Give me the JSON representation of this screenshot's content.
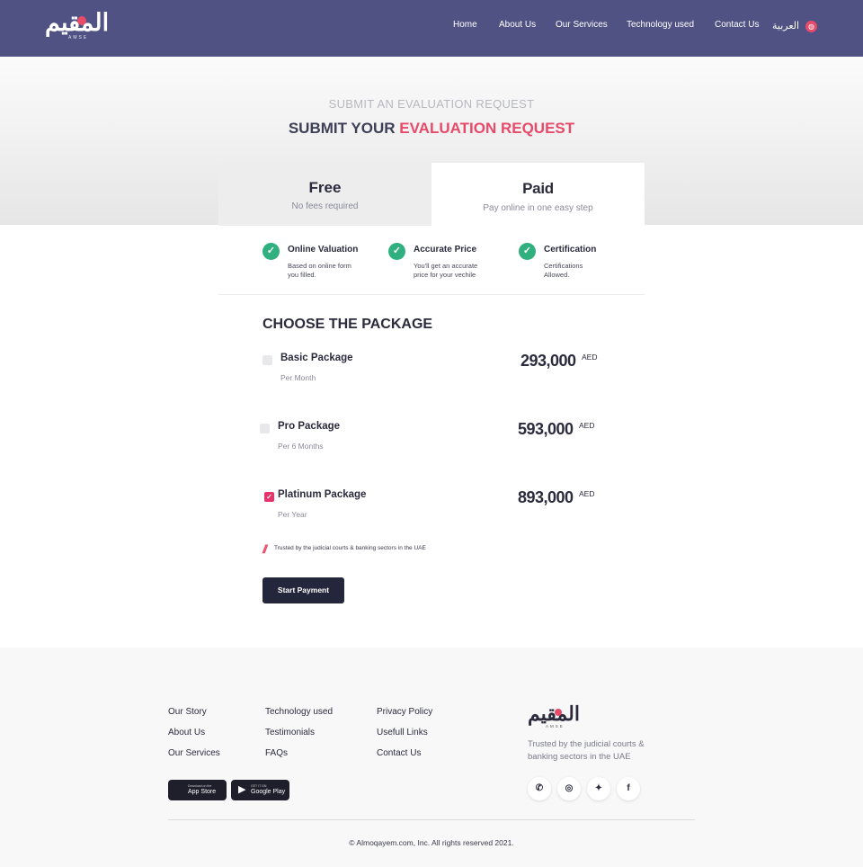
{
  "header": {
    "logo_text": "المقيم",
    "logo_sub": "AMSE",
    "nav": [
      "Home",
      "About Us",
      "Our Services",
      "Technology used",
      "Contact Us"
    ],
    "language": "العربية",
    "globe_icon": "globe-icon"
  },
  "hero": {
    "subtitle": "SUBMIT AN EVALUATION REQUEST",
    "title_main": "SUBMIT YOUR ",
    "title_accent": "EVALUATION REQUEST"
  },
  "tabs": {
    "free": {
      "title": "Free",
      "subtitle": "No fees required"
    },
    "paid": {
      "title": "Paid",
      "subtitle": "Pay online in one easy step"
    }
  },
  "features": [
    {
      "title": "Online Valuation",
      "desc": "Based on online form\nyou filled."
    },
    {
      "title": "Accurate Price",
      "desc": "You'll get an accurate\n price for your vechile"
    },
    {
      "title": "Certification",
      "desc": "Certifications\nAllowed."
    }
  ],
  "packages": {
    "heading": "CHOOSE THE PACKAGE",
    "items": [
      {
        "name": "Basic Package",
        "period": "Per Month",
        "price": "293,000",
        "currency": "AED",
        "selected": false
      },
      {
        "name": "Pro Package",
        "period": "Per 6 Months",
        "price": "593,000",
        "currency": "AED",
        "selected": false
      },
      {
        "name": "Platinum Package",
        "period": "Per Year",
        "price": "893,000",
        "currency": "AED",
        "selected": true
      }
    ],
    "trusted": "Trusted by the judicial courts & banking sectors in the UAE",
    "pay_button": "Start Payment"
  },
  "footer": {
    "col1": [
      "Our Story",
      "About Us",
      "Our Services"
    ],
    "col2": [
      "Technology used",
      "Testimonials",
      "FAQs"
    ],
    "col3": [
      "Privacy Policy",
      "Usefull Links",
      "Contact Us"
    ],
    "app_store": {
      "small": "Download on the",
      "big": "App Store"
    },
    "google_play": {
      "small": "GET IT ON",
      "big": "Google Play"
    },
    "logo_text": "المقيم",
    "logo_sub": "AMSE",
    "trusted": "Trusted by the judicial courts & banking sectors in the UAE",
    "social_icons": [
      "whatsapp-icon",
      "instagram-icon",
      "twitter-icon",
      "facebook-icon"
    ],
    "copyright": "© Almoqayem.com, Inc. All rights reserved 2021."
  },
  "colors": {
    "header": "#4f5283",
    "accent": "#e84a6a",
    "check": "#30b07e",
    "button": "#24263b"
  }
}
